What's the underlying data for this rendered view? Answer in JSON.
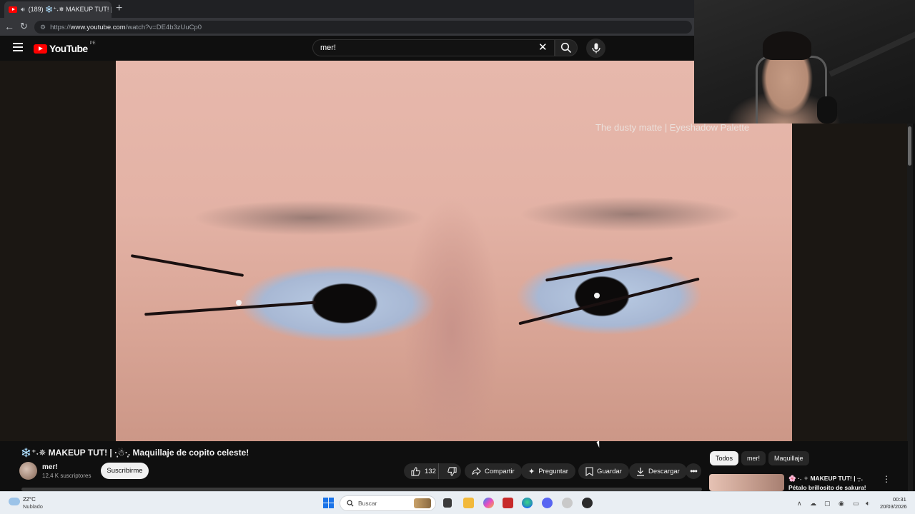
{
  "browser": {
    "tab_title": "(189) ❄️⁺˖✵ MAKEUP TUT! | ·̩͙",
    "url_prefix": "https://",
    "url_host": "www.youtube.com",
    "url_path": "/watch?v=DE4b3zUuCp0"
  },
  "header": {
    "logo_text": "YouTube",
    "country_code": "PE",
    "search_value": "mer!"
  },
  "video": {
    "caption": "The dusty matte | Eyeshadow Palette"
  },
  "details": {
    "title": "❄️⁺˖✵ MAKEUP TUT! | ·̩͙☃·̩͙. Maquillaje de copito celeste!",
    "channel_name": "mer!",
    "channel_subs": "12,4 K suscriptores",
    "subscribe_label": "Suscribirme",
    "like_count": "132",
    "share_label": "Compartir",
    "ask_label": "Preguntar",
    "save_label": "Guardar",
    "download_label": "Descargar"
  },
  "sidebar": {
    "chips": [
      "Todos",
      "mer!",
      "Maquillaje"
    ],
    "recommendation": {
      "title_line1": "🌸 ·˖ ✧ MAKEUP TUT! | ·̩͙·.",
      "title_line2": "Pétalo brillosito de sakura!"
    }
  },
  "taskbar": {
    "weather_temp": "22°C",
    "weather_desc": "Nublado",
    "search_placeholder": "Buscar",
    "time": "00:31",
    "date": "20/03/2026"
  },
  "colors": {
    "yt_red": "#ff0000",
    "page_bg": "#0f0f0f",
    "pill_bg": "#272727",
    "taskbar_bg": "#e9eef3"
  }
}
